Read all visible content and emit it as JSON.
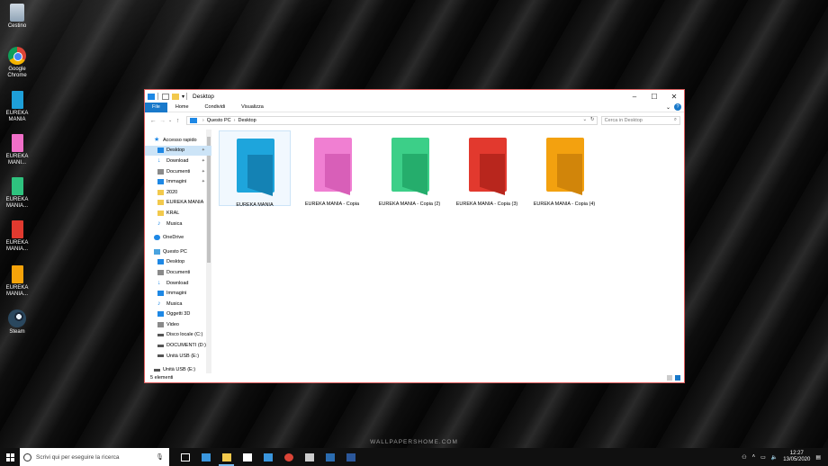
{
  "desktop": {
    "icons": [
      {
        "label": "Cestino",
        "icon": "recycle-bin-icon"
      },
      {
        "label": "Google Chrome",
        "icon": "chrome-icon"
      },
      {
        "label": "EUREKA MANIA",
        "icon": "book-icon",
        "color": "#1e9fd8"
      },
      {
        "label": "EUREKA MANI...",
        "icon": "book-icon",
        "color": "#f06fc8"
      },
      {
        "label": "EUREKA MANIA...",
        "icon": "book-icon",
        "color": "#2ec27e"
      },
      {
        "label": "EUREKA MANIA...",
        "icon": "book-icon",
        "color": "#e03a2f"
      },
      {
        "label": "EUREKA MANIA...",
        "icon": "book-icon",
        "color": "#f5a30a"
      },
      {
        "label": "Steam",
        "icon": "steam-icon"
      }
    ],
    "watermark": "WALLPAPERSHOME.COM"
  },
  "window": {
    "title": "Desktop",
    "ribbon_tabs": [
      "File",
      "Home",
      "Condividi",
      "Visualizza"
    ],
    "address": {
      "segments": [
        "Questo PC",
        "Desktop"
      ]
    },
    "search_placeholder": "Cerca in Desktop",
    "sidebar": [
      {
        "label": "Accesso rapido",
        "icon": "star-icon",
        "level": 0
      },
      {
        "label": "Desktop",
        "icon": "desktop-folder-icon",
        "level": 1,
        "pinned": true,
        "selected": true
      },
      {
        "label": "Download",
        "icon": "download-icon",
        "level": 1,
        "pinned": true
      },
      {
        "label": "Documenti",
        "icon": "documents-icon",
        "level": 1,
        "pinned": true
      },
      {
        "label": "Immagini",
        "icon": "pictures-icon",
        "level": 1,
        "pinned": true
      },
      {
        "label": "2020",
        "icon": "folder-icon",
        "level": 1
      },
      {
        "label": "EUREKA MANIA",
        "icon": "folder-icon",
        "level": 1
      },
      {
        "label": "KRAL",
        "icon": "folder-icon",
        "level": 1
      },
      {
        "label": "Musica",
        "icon": "music-icon",
        "level": 1
      },
      {
        "label": "OneDrive",
        "icon": "onedrive-icon",
        "level": 0
      },
      {
        "label": "Questo PC",
        "icon": "this-pc-icon",
        "level": 0
      },
      {
        "label": "Desktop",
        "icon": "desktop-folder-icon",
        "level": 1
      },
      {
        "label": "Documenti",
        "icon": "documents-icon",
        "level": 1
      },
      {
        "label": "Download",
        "icon": "download-icon",
        "level": 1
      },
      {
        "label": "Immagini",
        "icon": "pictures-icon",
        "level": 1
      },
      {
        "label": "Musica",
        "icon": "music-icon",
        "level": 1
      },
      {
        "label": "Oggetti 3D",
        "icon": "objects-3d-icon",
        "level": 1
      },
      {
        "label": "Video",
        "icon": "video-icon",
        "level": 1
      },
      {
        "label": "Disco locale (C:)",
        "icon": "drive-icon",
        "level": 1
      },
      {
        "label": "DOCUMENTI (D:)",
        "icon": "drive-icon",
        "level": 1
      },
      {
        "label": "Unità USB (E:)",
        "icon": "usb-drive-icon",
        "level": 1
      },
      {
        "label": "Unità USB (E:)",
        "icon": "usb-drive-icon",
        "level": 0
      }
    ],
    "files": [
      {
        "label": "EUREKA MANIA",
        "color": "#1ea5dc",
        "dark": "#1482b4",
        "selected": true
      },
      {
        "label": "EUREKA MANIA - Copia",
        "color": "#f07fd2",
        "dark": "#d85fb8",
        "selected": false
      },
      {
        "label": "EUREKA MANIA - Copia (2)",
        "color": "#3ccf88",
        "dark": "#25ad6c",
        "selected": false
      },
      {
        "label": "EUREKA MANIA - Copia (3)",
        "color": "#e2392e",
        "dark": "#b8261d",
        "selected": false
      },
      {
        "label": "EUREKA MANIA - Copia (4)",
        "color": "#f3a10f",
        "dark": "#d1850a",
        "selected": false
      }
    ],
    "status": "5 elementi"
  },
  "taskbar": {
    "search_placeholder": "Scrivi qui per eseguire la ricerca",
    "apps": [
      {
        "name": "task-view-icon",
        "color": "#ffffff"
      },
      {
        "name": "edge-icon",
        "color": "#3a96dd"
      },
      {
        "name": "file-explorer-icon",
        "color": "#f2c94c",
        "active": true
      },
      {
        "name": "store-icon",
        "color": "#ffffff"
      },
      {
        "name": "mail-icon",
        "color": "#3a96dd"
      },
      {
        "name": "chrome-icon",
        "color": "#db4437"
      },
      {
        "name": "photos-icon",
        "color": "#cccccc"
      },
      {
        "name": "movies-icon",
        "color": "#2b6cb0"
      },
      {
        "name": "word-icon",
        "color": "#2b579a"
      }
    ],
    "time": "12:27",
    "date": "13/05/2020"
  }
}
